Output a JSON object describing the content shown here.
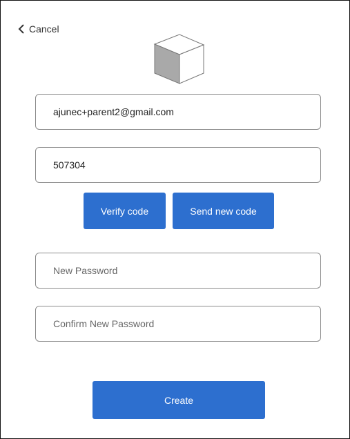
{
  "header": {
    "cancel_label": "Cancel"
  },
  "logo": {
    "icon": "cube-icon"
  },
  "form": {
    "email_value": "ajunec+parent2@gmail.com",
    "code_value": "507304",
    "verify_label": "Verify code",
    "send_new_label": "Send new code",
    "new_password_placeholder": "New Password",
    "confirm_password_placeholder": "Confirm New Password",
    "create_label": "Create"
  },
  "colors": {
    "primary": "#2d6fcf",
    "border": "#8a8a8a"
  }
}
